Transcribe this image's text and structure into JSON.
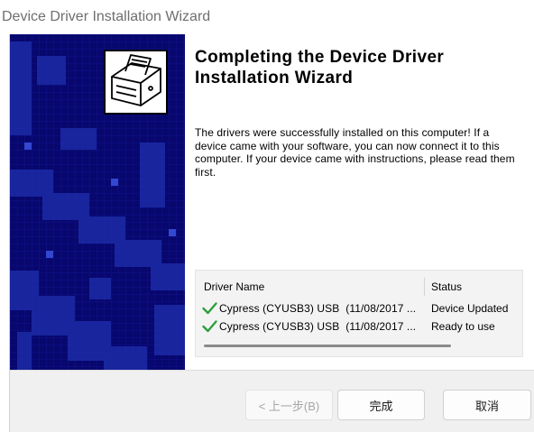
{
  "window": {
    "title": "Device Driver Installation Wizard"
  },
  "banner": {
    "icon": "driver-install-icon"
  },
  "content": {
    "heading": "Completing the Device Driver Installation Wizard",
    "message": "The drivers were successfully installed on this computer! If a device came with your software, you can now connect it to this computer. If your device came with instructions, please read them first."
  },
  "driver_list": {
    "columns": [
      "Driver Name",
      "Status"
    ],
    "rows": [
      {
        "icon": "green-check-icon",
        "name": "Cypress (CYUSB3) USB  (11/08/2017 ...",
        "status": "Device Updated"
      },
      {
        "icon": "green-check-icon",
        "name": "Cypress (CYUSB3) USB  (11/08/2017 ...",
        "status": "Ready to use"
      }
    ]
  },
  "buttons": {
    "back": {
      "label": "< 上一步(B)",
      "enabled": false
    },
    "finish": {
      "label": "完成",
      "enabled": true
    },
    "cancel": {
      "label": "取消",
      "enabled": true
    }
  },
  "colors": {
    "banner_background": "#07076e",
    "banner_accent": "#1c2ba6",
    "success_check": "#2a9d3b",
    "footer_background": "#f0f0f0"
  }
}
